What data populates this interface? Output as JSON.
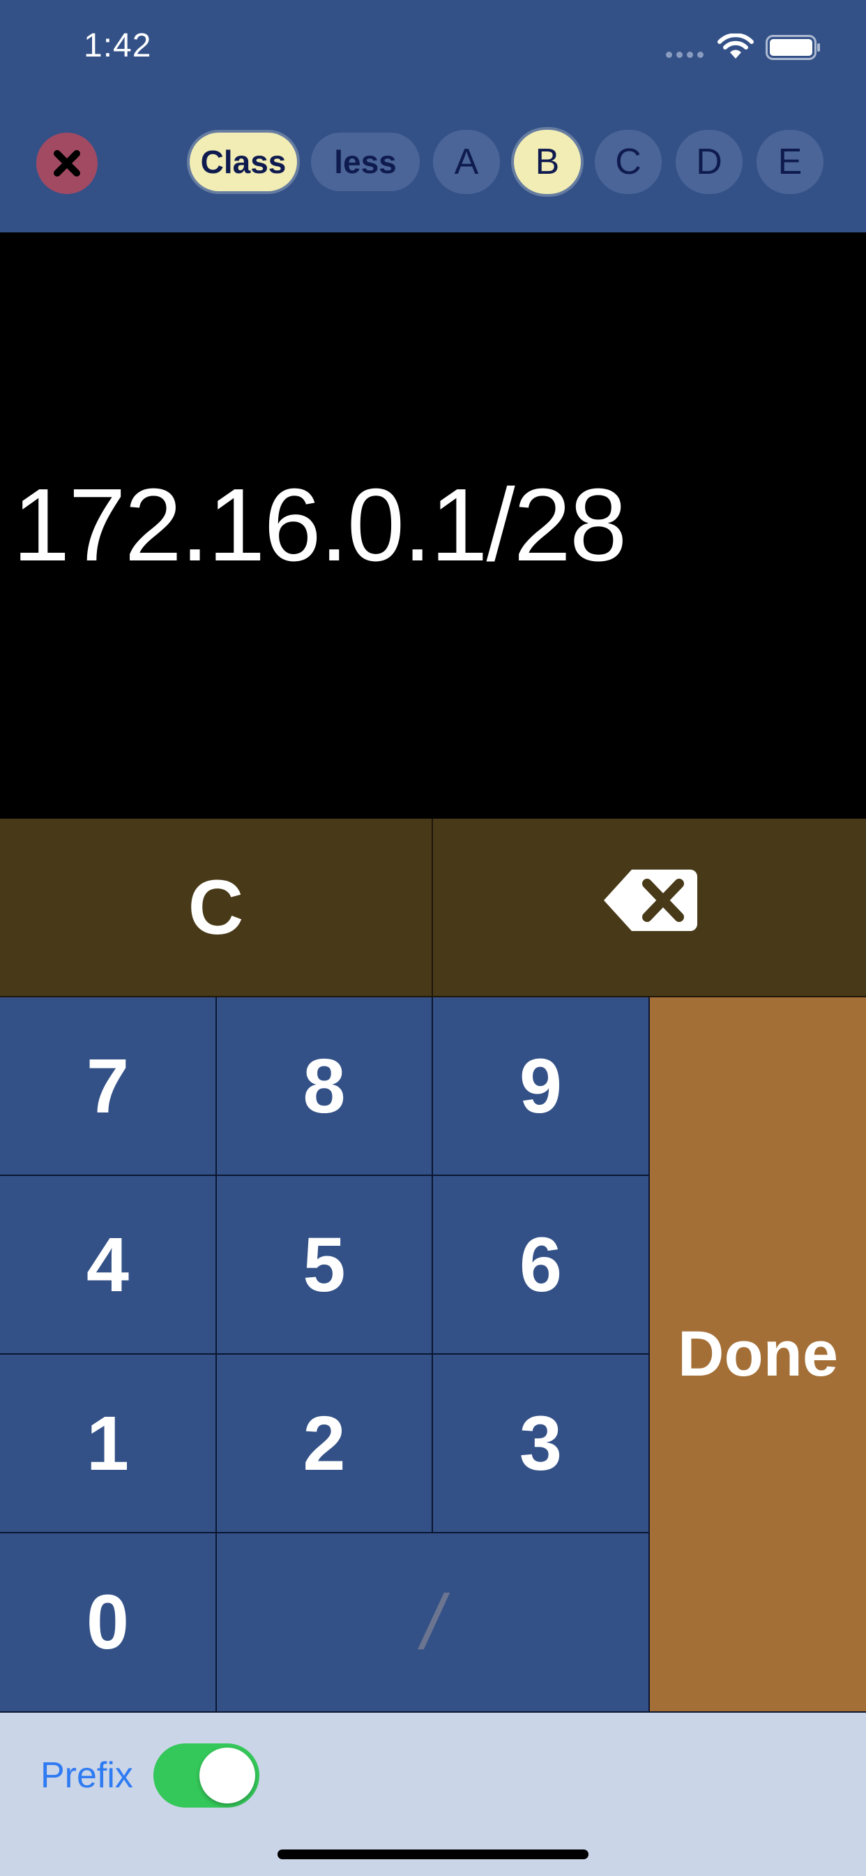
{
  "status_bar": {
    "time": "1:42"
  },
  "toolbar": {
    "chips": [
      {
        "label": "Class",
        "selected": true
      },
      {
        "label": "less",
        "selected": false
      },
      {
        "label": "A",
        "selected": false
      },
      {
        "label": "B",
        "selected": true
      },
      {
        "label": "C",
        "selected": false
      },
      {
        "label": "D",
        "selected": false
      },
      {
        "label": "E",
        "selected": false
      }
    ]
  },
  "display": {
    "value": "172.16.0.1/28"
  },
  "keypad": {
    "clear_label": "C",
    "keys": {
      "k7": "7",
      "k8": "8",
      "k9": "9",
      "k4": "4",
      "k5": "5",
      "k6": "6",
      "k1": "1",
      "k2": "2",
      "k3": "3",
      "k0": "0",
      "slash": "/"
    },
    "done_label": "Done"
  },
  "bottom_bar": {
    "prefix_label": "Prefix",
    "prefix_on": true
  },
  "colors": {
    "header_bg": "#335187",
    "chip_selected": "#f1edb4",
    "chip_unselected": "#4b6598",
    "close_button": "#a34a63",
    "util_key": "#483a18",
    "done_key": "#a46f37",
    "toggle_on": "#34c759",
    "prefix_text": "#2f7bf2"
  },
  "icons": {
    "close": "close-x-icon",
    "backspace": "backspace-icon",
    "wifi": "wifi-icon",
    "battery": "battery-icon"
  }
}
